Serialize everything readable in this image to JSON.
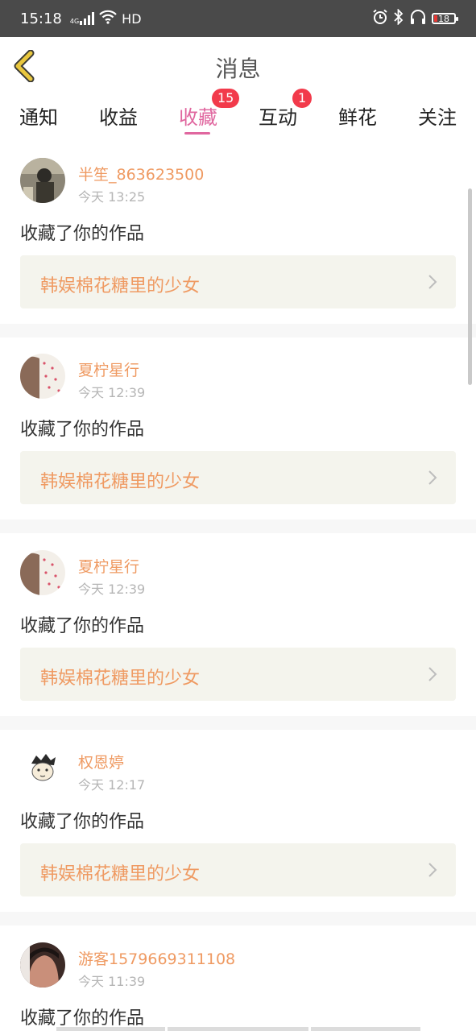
{
  "status_bar": {
    "time": "15:18",
    "network": "4G",
    "hd": "HD",
    "battery": "18",
    "icons": [
      "signal-icon",
      "wifi-icon",
      "alarm-icon",
      "bluetooth-icon",
      "headphones-icon",
      "battery-icon"
    ]
  },
  "header": {
    "title": "消息",
    "back_icon": "chevron-left-icon"
  },
  "tabs": [
    {
      "label": "通知",
      "active": false,
      "badge": ""
    },
    {
      "label": "收益",
      "active": false,
      "badge": ""
    },
    {
      "label": "收藏",
      "active": true,
      "badge": "15"
    },
    {
      "label": "互动",
      "active": false,
      "badge": "1"
    },
    {
      "label": "鲜花",
      "active": false,
      "badge": ""
    },
    {
      "label": "关注",
      "active": false,
      "badge": ""
    }
  ],
  "colors": {
    "accent": "#e0679f",
    "username": "#ef9a62",
    "badge": "#f23a4b",
    "back_arrow": "#e9c73e"
  },
  "messages": [
    {
      "user": "半笙_863623500",
      "time": "今天 13:25",
      "action": "收藏了你的作品",
      "work": "韩娱棉花糖里的少女"
    },
    {
      "user": "夏柠星行",
      "time": "今天 12:39",
      "action": "收藏了你的作品",
      "work": "韩娱棉花糖里的少女"
    },
    {
      "user": "夏柠星行",
      "time": "今天 12:39",
      "action": "收藏了你的作品",
      "work": "韩娱棉花糖里的少女"
    },
    {
      "user": "权恩婷",
      "time": "今天 12:17",
      "action": "收藏了你的作品",
      "work": "韩娱棉花糖里的少女"
    },
    {
      "user": "游客1579669311108",
      "time": "今天 11:39",
      "action": "收藏了你的作品",
      "work": ""
    }
  ]
}
